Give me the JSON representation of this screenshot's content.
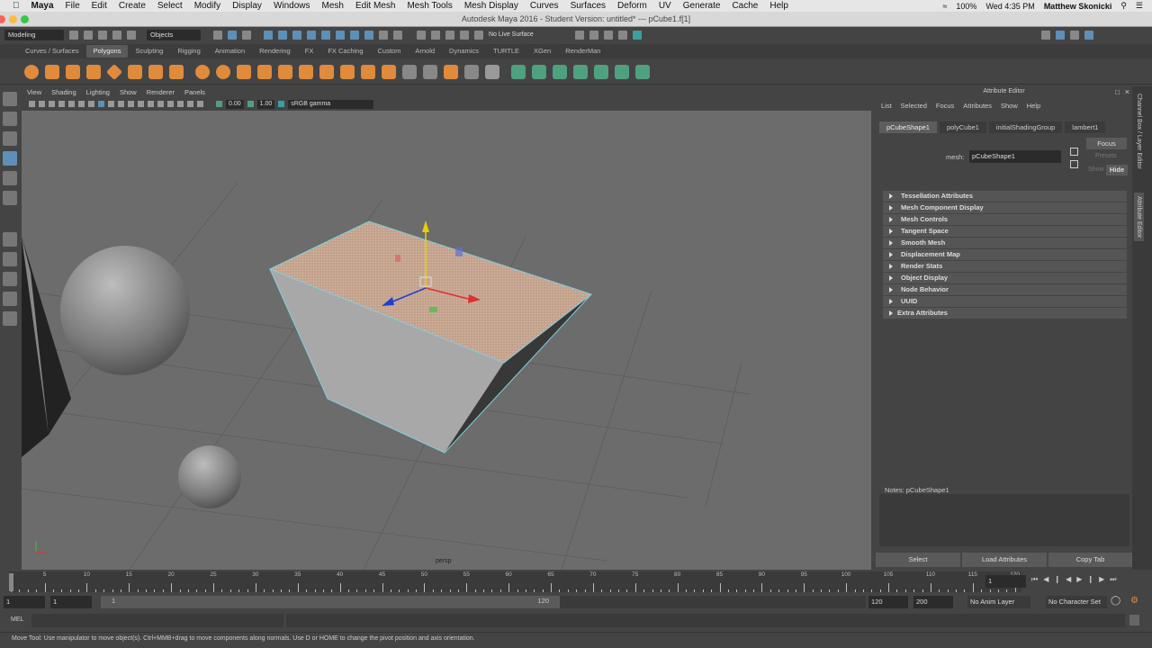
{
  "mac_menu": {
    "app": "Maya",
    "items": [
      "File",
      "Edit",
      "Create",
      "Select",
      "Modify",
      "Display",
      "Windows",
      "Mesh",
      "Edit Mesh",
      "Mesh Tools",
      "Mesh Display",
      "Curves",
      "Surfaces",
      "Deform",
      "UV",
      "Generate",
      "Cache",
      "Help"
    ],
    "battery": "100%",
    "clock": "Wed 4:35 PM",
    "user": "Matthew Skonicki"
  },
  "window_title": "Autodesk Maya 2016 - Student Version: untitled*  ---  pCube1.f[1]",
  "status_line": {
    "menu_set": "Modeling",
    "selection_mode": "Objects",
    "live_surface": "No Live Surface"
  },
  "shelf_tabs": [
    "Curves / Surfaces",
    "Polygons",
    "Sculpting",
    "Rigging",
    "Animation",
    "Rendering",
    "FX",
    "FX Caching",
    "Custom",
    "Arnold",
    "Dynamics",
    "TURTLE",
    "XGen",
    "RenderMan"
  ],
  "shelf_active": "Polygons",
  "panel": {
    "menu": [
      "View",
      "Shading",
      "Lighting",
      "Show",
      "Renderer",
      "Panels"
    ],
    "exposure": "0.00",
    "gamma": "1.00",
    "color_space": "sRGB gamma",
    "camera": "persp"
  },
  "attribute_editor": {
    "title": "Attribute Editor",
    "menu": [
      "List",
      "Selected",
      "Focus",
      "Attributes",
      "Show",
      "Help"
    ],
    "tabs": [
      "pCubeShape1",
      "polyCube1",
      "initialShadingGroup",
      "lambert1"
    ],
    "mesh_label": "mesh:",
    "mesh_value": "pCubeShape1",
    "focus": "Focus",
    "presets": "Presets",
    "show": "Show",
    "hide": "Hide",
    "sections": [
      "Tessellation Attributes",
      "Mesh Component Display",
      "Mesh Controls",
      "Tangent Space",
      "Smooth Mesh",
      "Displacement Map",
      "Render Stats",
      "Object Display",
      "Node Behavior",
      "UUID",
      "Extra Attributes"
    ],
    "notes": "Notes:  pCubeShape1",
    "buttons": [
      "Select",
      "Load Attributes",
      "Copy Tab"
    ]
  },
  "side_tabs": [
    "Channel Box / Layer Editor",
    "Attribute Editor"
  ],
  "timeline": {
    "ticks": [
      "5",
      "10",
      "15",
      "20",
      "25",
      "30",
      "35",
      "40",
      "45",
      "50",
      "55",
      "60",
      "65",
      "70",
      "75",
      "80",
      "85",
      "90",
      "95",
      "100",
      "105",
      "110",
      "115",
      "120"
    ],
    "current_frame": "1"
  },
  "range": {
    "start": "1",
    "playback_start": "1",
    "slider_start": "1",
    "slider_end": "120",
    "playback_end": "120",
    "end": "200",
    "anim_layer": "No Anim Layer",
    "char_set": "No Character Set"
  },
  "mel_label": "MEL",
  "help_line": "Move Tool: Use manipulator to move object(s). Ctrl+MMB+drag to move components along normals. Use D or HOME to change the pivot position and axis orientation."
}
